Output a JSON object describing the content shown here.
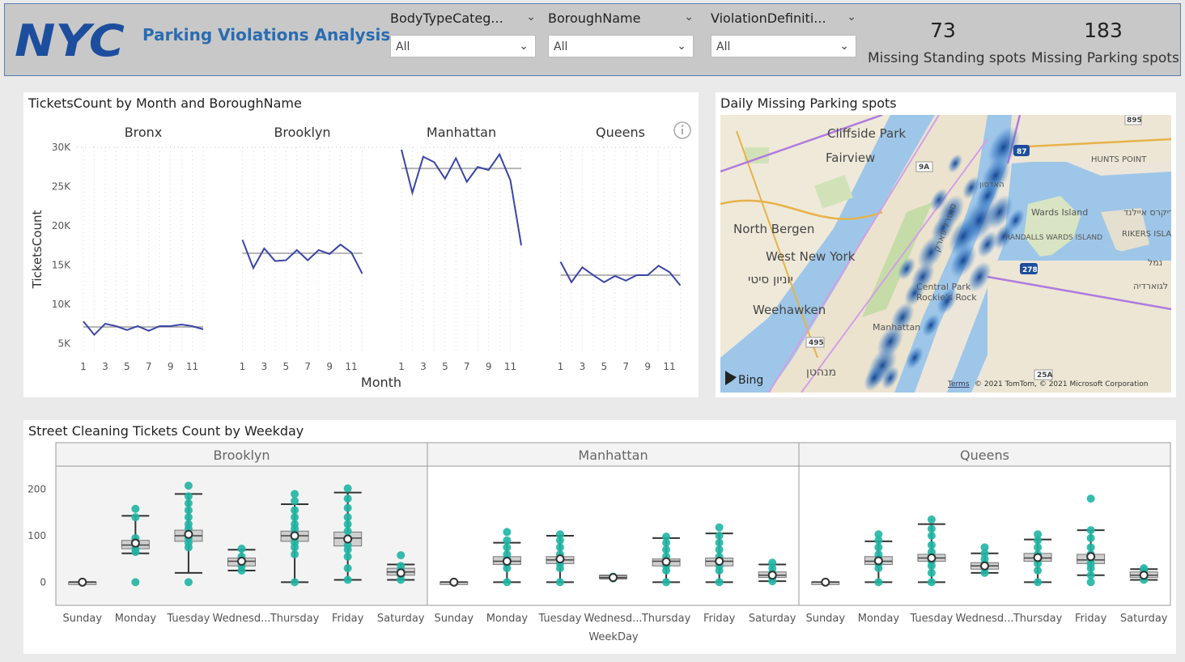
{
  "header": {
    "logo_text": "NYC",
    "title": "Parking Violations Analysis",
    "slicers": [
      {
        "label": "BodyTypeCateg...",
        "value": "All"
      },
      {
        "label": "BoroughName",
        "value": "All"
      },
      {
        "label": "ViolationDefiniti...",
        "value": "All"
      }
    ],
    "kpis": [
      {
        "value": "73",
        "label": "Missing Standing spots"
      },
      {
        "value": "183",
        "label": "Missing Parking spots"
      }
    ]
  },
  "line_panel": {
    "title": "TicketsCount by Month and BoroughName",
    "info_icon": "info-icon"
  },
  "map_panel": {
    "title": "Daily Missing Parking spots",
    "labels": [
      "Cliffside Park",
      "Fairview",
      "North Bergen",
      "West New York",
      "יוניון סיטי",
      "Weehawken",
      "Manhattan",
      "Central Park",
      "Rockie's Rock",
      "Wards Island",
      "RANDALLS WARDS ISLAND",
      "HUNTS POINT",
      "RIKERS ISLAND",
      "ריקרס איילנד",
      "נמל",
      "לגוארדיה",
      "מנהטן",
      "סנטרל פארק",
      "האדסון"
    ],
    "shields": [
      "895",
      "87",
      "9A",
      "278",
      "495",
      "25A"
    ],
    "bing": "Bing",
    "terms": "Terms",
    "copyright": "© 2021 TomTom, © 2021 Microsoft Corporation"
  },
  "box_panel": {
    "title": "Street Cleaning Tickets Count by Weekday",
    "xlabel": "WeekDay"
  },
  "chart_data": [
    {
      "type": "line",
      "title": "TicketsCount by Month and BoroughName",
      "xlabel": "Month",
      "ylabel": "TicketsCount",
      "ylim": [
        4000,
        30000
      ],
      "yticks": [
        "5K",
        "10K",
        "15K",
        "20K",
        "25K",
        "30K"
      ],
      "ytick_values": [
        5000,
        10000,
        15000,
        20000,
        25000,
        30000
      ],
      "x": [
        1,
        2,
        3,
        4,
        5,
        6,
        7,
        8,
        9,
        10,
        11,
        12
      ],
      "xticks": [
        "1",
        "3",
        "5",
        "7",
        "9",
        "11"
      ],
      "series": [
        {
          "name": "Bronx",
          "values": [
            7800,
            6100,
            7500,
            7200,
            6700,
            7200,
            6600,
            7200,
            7200,
            7400,
            7200,
            6800
          ],
          "avg": 7100
        },
        {
          "name": "Brooklyn",
          "values": [
            18200,
            14600,
            17100,
            15500,
            15600,
            16900,
            15600,
            16900,
            16400,
            17600,
            16600,
            13900
          ],
          "avg": 16500
        },
        {
          "name": "Manhattan",
          "values": [
            29700,
            24200,
            28800,
            28100,
            26000,
            28600,
            25600,
            27500,
            27100,
            29100,
            25800,
            17500
          ],
          "avg": 27300
        },
        {
          "name": "Queens",
          "values": [
            15400,
            12800,
            14700,
            13700,
            12800,
            13600,
            13000,
            13700,
            13700,
            14900,
            14100,
            12400
          ],
          "avg": 13700
        }
      ],
      "grid": true,
      "line_color": "#3a45a7"
    },
    {
      "type": "box",
      "title": "Street Cleaning Tickets Count by Weekday",
      "xlabel": "WeekDay",
      "ylim": [
        -50,
        250
      ],
      "yticks": [
        "0",
        "100",
        "200"
      ],
      "ytick_values": [
        0,
        100,
        200
      ],
      "categories": [
        "Sunday",
        "Monday",
        "Tuesday",
        "Wednesd...",
        "Thursday",
        "Friday",
        "Saturday"
      ],
      "facets": [
        {
          "name": "Brooklyn",
          "boxes": [
            {
              "min": 0,
              "q1": 0,
              "median": 0,
              "q3": 0,
              "max": 0,
              "mean": 0,
              "points": [
                0
              ]
            },
            {
              "min": 62,
              "q1": 72,
              "median": 80,
              "q3": 90,
              "max": 143,
              "mean": 84,
              "points": [
                0,
                65,
                72,
                80,
                88,
                95,
                140,
                158
              ]
            },
            {
              "min": 20,
              "q1": 88,
              "median": 100,
              "q3": 112,
              "max": 190,
              "mean": 103,
              "points": [
                0,
                75,
                85,
                95,
                105,
                115,
                125,
                140,
                155,
                170,
                185,
                208
              ]
            },
            {
              "min": 25,
              "q1": 35,
              "median": 45,
              "q3": 52,
              "max": 70,
              "mean": 45,
              "points": [
                25,
                35,
                45,
                55,
                72
              ]
            },
            {
              "min": 0,
              "q1": 88,
              "median": 100,
              "q3": 110,
              "max": 168,
              "mean": 100,
              "points": [
                0,
                60,
                75,
                85,
                95,
                105,
                115,
                125,
                140,
                155,
                175,
                190
              ]
            },
            {
              "min": 5,
              "q1": 78,
              "median": 95,
              "q3": 108,
              "max": 193,
              "mean": 93,
              "points": [
                5,
                30,
                55,
                70,
                80,
                95,
                110,
                125,
                140,
                160,
                180,
                202
              ]
            },
            {
              "min": 5,
              "q1": 15,
              "median": 22,
              "q3": 30,
              "max": 38,
              "mean": 20,
              "points": [
                5,
                15,
                25,
                35,
                58
              ]
            }
          ]
        },
        {
          "name": "Manhattan",
          "boxes": [
            {
              "min": 0,
              "q1": 0,
              "median": 0,
              "q3": 0,
              "max": 0,
              "mean": 0,
              "points": [
                0
              ]
            },
            {
              "min": 0,
              "q1": 38,
              "median": 45,
              "q3": 55,
              "max": 85,
              "mean": 45,
              "points": [
                0,
                30,
                40,
                50,
                60,
                75,
                90,
                108
              ]
            },
            {
              "min": 0,
              "q1": 40,
              "median": 48,
              "q3": 55,
              "max": 100,
              "mean": 50,
              "points": [
                0,
                30,
                40,
                50,
                60,
                75,
                90,
                103
              ]
            },
            {
              "min": 8,
              "q1": 8,
              "median": 10,
              "q3": 14,
              "max": 14,
              "mean": 10,
              "points": [
                8,
                12
              ]
            },
            {
              "min": 0,
              "q1": 35,
              "median": 45,
              "q3": 50,
              "max": 95,
              "mean": 44,
              "points": [
                0,
                25,
                35,
                45,
                55,
                70,
                85,
                98
              ]
            },
            {
              "min": 0,
              "q1": 35,
              "median": 45,
              "q3": 52,
              "max": 105,
              "mean": 45,
              "points": [
                0,
                25,
                35,
                45,
                55,
                70,
                85,
                100,
                118
              ]
            },
            {
              "min": 2,
              "q1": 10,
              "median": 15,
              "q3": 22,
              "max": 38,
              "mean": 15,
              "points": [
                2,
                10,
                20,
                30,
                42
              ]
            }
          ]
        },
        {
          "name": "Queens",
          "boxes": [
            {
              "min": 0,
              "q1": 0,
              "median": 0,
              "q3": 0,
              "max": 0,
              "mean": 0,
              "points": [
                0
              ]
            },
            {
              "min": 0,
              "q1": 38,
              "median": 45,
              "q3": 55,
              "max": 88,
              "mean": 46,
              "points": [
                0,
                30,
                40,
                50,
                60,
                75,
                90,
                103
              ]
            },
            {
              "min": 0,
              "q1": 45,
              "median": 52,
              "q3": 60,
              "max": 125,
              "mean": 52,
              "points": [
                0,
                20,
                35,
                45,
                55,
                65,
                80,
                100,
                115,
                135
              ]
            },
            {
              "min": 20,
              "q1": 28,
              "median": 35,
              "q3": 42,
              "max": 62,
              "mean": 35,
              "points": [
                20,
                30,
                40,
                50,
                62,
                75
              ]
            },
            {
              "min": 0,
              "q1": 45,
              "median": 52,
              "q3": 62,
              "max": 92,
              "mean": 53,
              "points": [
                0,
                25,
                40,
                50,
                60,
                75,
                90,
                103
              ]
            },
            {
              "min": 15,
              "q1": 40,
              "median": 48,
              "q3": 60,
              "max": 112,
              "mean": 55,
              "points": [
                0,
                15,
                30,
                40,
                50,
                60,
                75,
                95,
                112,
                180
              ]
            },
            {
              "min": 5,
              "q1": 10,
              "median": 15,
              "q3": 22,
              "max": 28,
              "mean": 15,
              "points": [
                5,
                12,
                18,
                25,
                30
              ]
            }
          ]
        }
      ],
      "point_color": "#1fb5a3"
    }
  ],
  "colors": {
    "accent": "#2b6cb0",
    "line": "#3a45a7",
    "avg_line": "#b4b4b4",
    "teal": "#1fb5a3",
    "logo": "#1d4e9e"
  }
}
